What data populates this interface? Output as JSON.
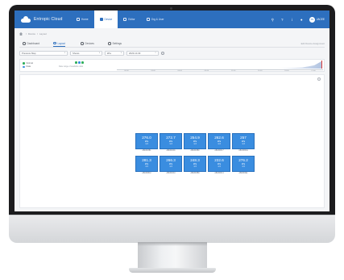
{
  "app": {
    "brand": "Entropic Cloud",
    "nav": [
      {
        "label": "Home",
        "active": false
      },
      {
        "label": "Device",
        "active": true
      },
      {
        "label": "Editor",
        "active": false
      },
      {
        "label": "Org & User",
        "active": false
      }
    ],
    "user": {
      "initials": "JS",
      "name": "JACEE"
    }
  },
  "breadcrumb": [
    "Device",
    "Layout"
  ],
  "tabs": [
    {
      "label": "Dashboard",
      "active": false
    },
    {
      "label": "Layout",
      "active": true
    },
    {
      "label": "Devices",
      "active": false
    },
    {
      "label": "Settings",
      "active": false
    }
  ],
  "tabs_right_link": "Edit Device Assignment",
  "filters": [
    {
      "value": "Pressure Map"
    },
    {
      "value": "Shows"
    },
    {
      "value": "kPa"
    },
    {
      "value": "2023-10-30"
    }
  ],
  "timeline": {
    "legend": [
      {
        "label": "Normal",
        "color": "#2eae5a"
      },
      {
        "label": "Data",
        "color": "#3a8de0"
      }
    ],
    "subtitle": "Date range of available data",
    "mini_colors": [
      "#2eae5a",
      "#3a8de0",
      "#2eae5a"
    ],
    "ticks": [
      "00:00",
      "03:00",
      "06:00",
      "09:00",
      "12:00",
      "15:00",
      "18:00",
      "21:00"
    ]
  },
  "devices": [
    {
      "value": "276.0",
      "unit": "kPa",
      "sub": "1.3",
      "id": "AB03F8B1"
    },
    {
      "value": "272.7",
      "unit": "kPa",
      "sub": "1.3",
      "id": "AB03F8A6"
    },
    {
      "value": "254.9",
      "unit": "kPa",
      "sub": "1.3",
      "id": "AB03F8B0"
    },
    {
      "value": "262.6",
      "unit": "kPa",
      "sub": "1.3",
      "id": "AB03F8C7"
    },
    {
      "value": "257",
      "unit": "kPa",
      "sub": "1.3",
      "id": "AB03F8CE"
    },
    {
      "value": "281.3",
      "unit": "kPa",
      "sub": "1.3",
      "id": "AB03F8D2"
    },
    {
      "value": "266.3",
      "unit": "kPa",
      "sub": "1.3",
      "id": "AB03F8A3"
    },
    {
      "value": "248.3",
      "unit": "kPa",
      "sub": "1.3",
      "id": "AB03F8B9"
    },
    {
      "value": "232.6",
      "unit": "kPa",
      "sub": "1.3",
      "id": "AB03F8C4"
    },
    {
      "value": "276.2",
      "unit": "kPa",
      "sub": "1.3",
      "id": "AB03F8E1"
    }
  ]
}
